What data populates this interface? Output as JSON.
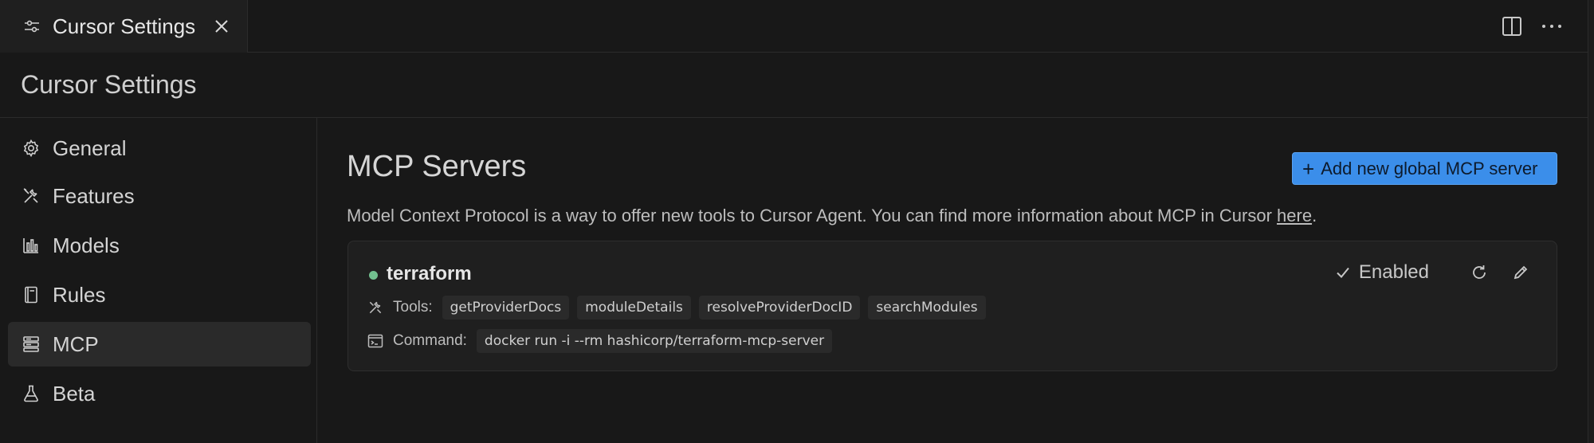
{
  "tab": {
    "label": "Cursor Settings"
  },
  "page": {
    "title": "Cursor Settings"
  },
  "sidebar": {
    "items": [
      {
        "label": "General",
        "icon": "gear-icon"
      },
      {
        "label": "Features",
        "icon": "tools-icon"
      },
      {
        "label": "Models",
        "icon": "bar-chart-icon"
      },
      {
        "label": "Rules",
        "icon": "book-icon"
      },
      {
        "label": "MCP",
        "icon": "server-icon",
        "active": true
      },
      {
        "label": "Beta",
        "icon": "flask-icon"
      }
    ]
  },
  "main": {
    "title": "MCP Servers",
    "add_button": {
      "plus": "+",
      "label": "Add new global MCP server"
    },
    "description": "Model Context Protocol is a way to offer new tools to Cursor Agent. You can find more information about MCP in Cursor ",
    "description_link": "here",
    "description_end": ".",
    "server": {
      "name": "terraform",
      "status_color": "#72c08f",
      "enabled_label": "Enabled",
      "tools_label": "Tools:",
      "tools": [
        "getProviderDocs",
        "moduleDetails",
        "resolveProviderDocID",
        "searchModules"
      ],
      "command_label": "Command:",
      "command": "docker run -i --rm hashicorp/terraform-mcp-server"
    }
  },
  "colors": {
    "accent": "#3b8eea",
    "background": "#181818",
    "card": "#1f1f1f"
  }
}
